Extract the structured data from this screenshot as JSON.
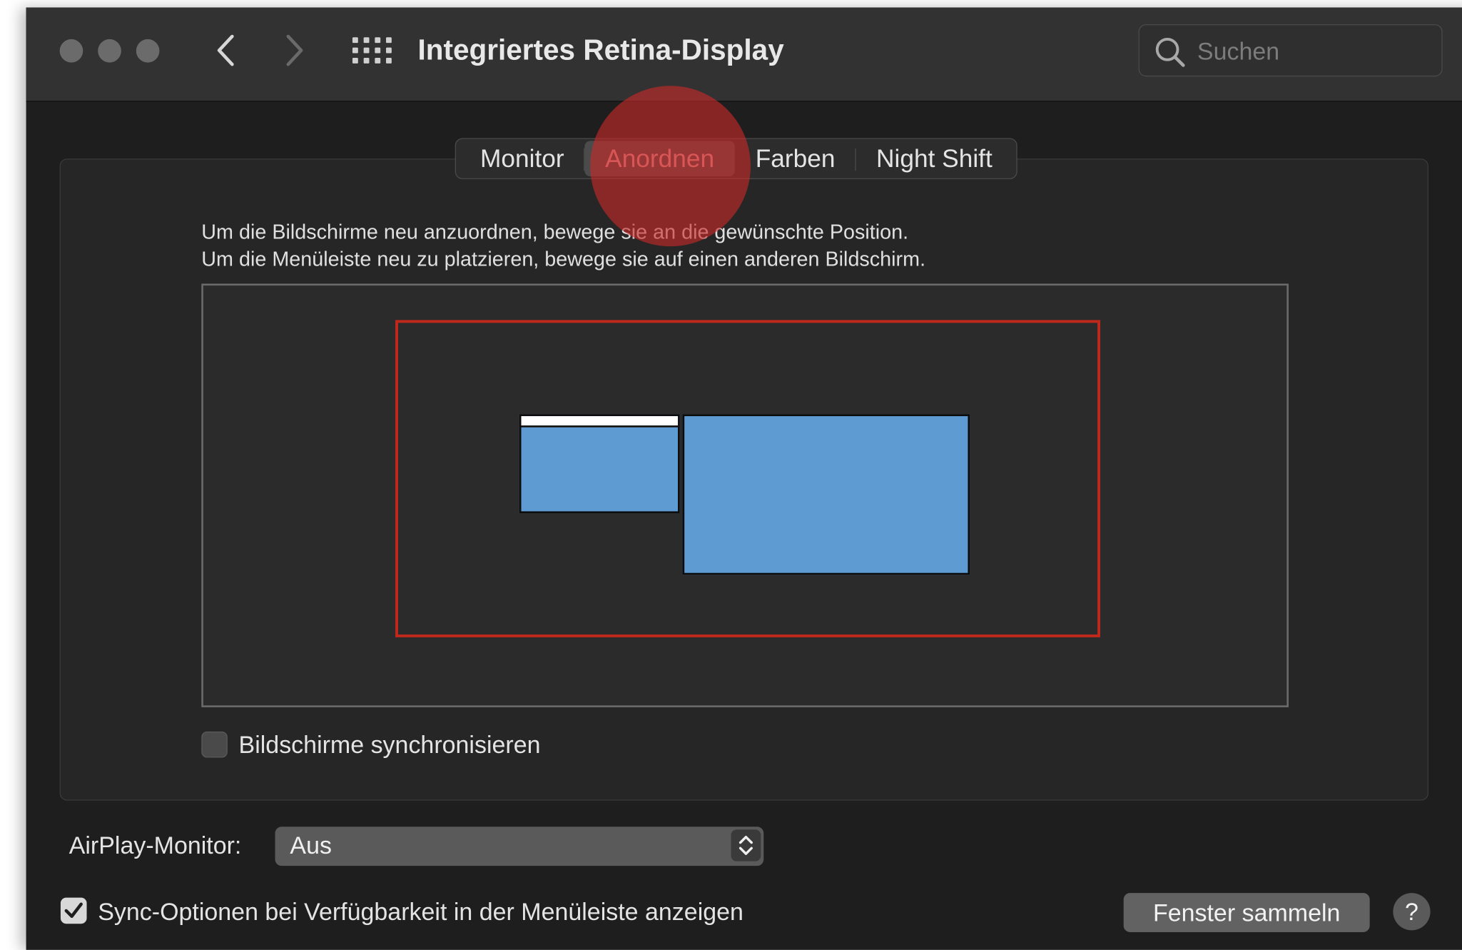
{
  "window": {
    "title": "Integriertes Retina-Display"
  },
  "search": {
    "placeholder": "Suchen"
  },
  "tabs": [
    {
      "label": "Monitor"
    },
    {
      "label": "Anordnen",
      "active": true
    },
    {
      "label": "Farben"
    },
    {
      "label": "Night Shift"
    }
  ],
  "arrange": {
    "instruction_line1": "Um die Bildschirme neu anzuordnen, bewege sie an die gewünschte Position.",
    "instruction_line2": "Um die Menüleiste neu zu platzieren, bewege sie auf einen anderen Bildschirm.",
    "mirror_label": "Bildschirme synchronisieren",
    "mirror_checked": false
  },
  "airplay": {
    "label": "AirPlay-Monitor:",
    "value": "Aus"
  },
  "footer": {
    "sync_label": "Sync-Optionen bei Verfügbarkeit in der Menüleiste anzeigen",
    "sync_checked": true,
    "gather_button": "Fenster sammeln",
    "help_button": "?"
  },
  "colors": {
    "highlight_border": "#c0281c",
    "display_fill": "#5e9bd3",
    "click_marker": "#c82828",
    "active_tab_text": "#f4a0a0"
  },
  "icons": {
    "back": "chevron-left-icon",
    "forward": "chevron-right-icon",
    "show_all": "grid-icon",
    "search": "magnifier-icon",
    "checkmark": "checkmark-icon",
    "stepper": "up-down-chevron-icon"
  }
}
